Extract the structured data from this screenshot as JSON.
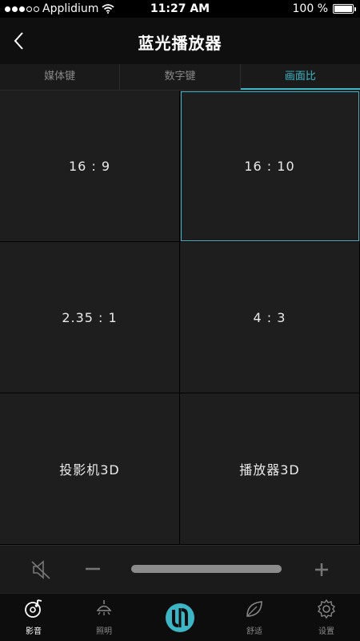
{
  "status_bar": {
    "carrier": "Applidium",
    "time": "11:27 AM",
    "battery": "100 %",
    "battery_level": 1.0
  },
  "nav": {
    "title": "蓝光播放器",
    "back_icon": "chevron-left-icon"
  },
  "tabs": [
    {
      "label": "媒体键",
      "active": false
    },
    {
      "label": "数字键",
      "active": false
    },
    {
      "label": "画面比",
      "active": true
    }
  ],
  "aspect_options": [
    {
      "label": "16 : 9",
      "selected": false
    },
    {
      "label": "16 : 10",
      "selected": true
    },
    {
      "label": "2.35 : 1",
      "selected": false
    },
    {
      "label": "4 : 3",
      "selected": false
    },
    {
      "label": "投影机3D",
      "selected": false
    },
    {
      "label": "播放器3D",
      "selected": false
    }
  ],
  "volume": {
    "mute_icon": "speaker-mute-icon",
    "minus_icon": "minus-icon",
    "plus_icon": "plus-icon",
    "level": 1.0
  },
  "tab_bar": {
    "items": [
      {
        "label": "影音",
        "icon": "music-disc-icon",
        "active": true
      },
      {
        "label": "照明",
        "icon": "ceiling-lamp-icon",
        "active": false
      },
      {
        "label": "舒适",
        "icon": "leaf-icon",
        "active": false
      },
      {
        "label": "设置",
        "icon": "gear-icon",
        "active": false
      }
    ],
    "center_icon": "app-logo-icon"
  },
  "colors": {
    "accent": "#3cb6c7",
    "cell_bg": "#1e1e1e",
    "background": "#000000"
  }
}
